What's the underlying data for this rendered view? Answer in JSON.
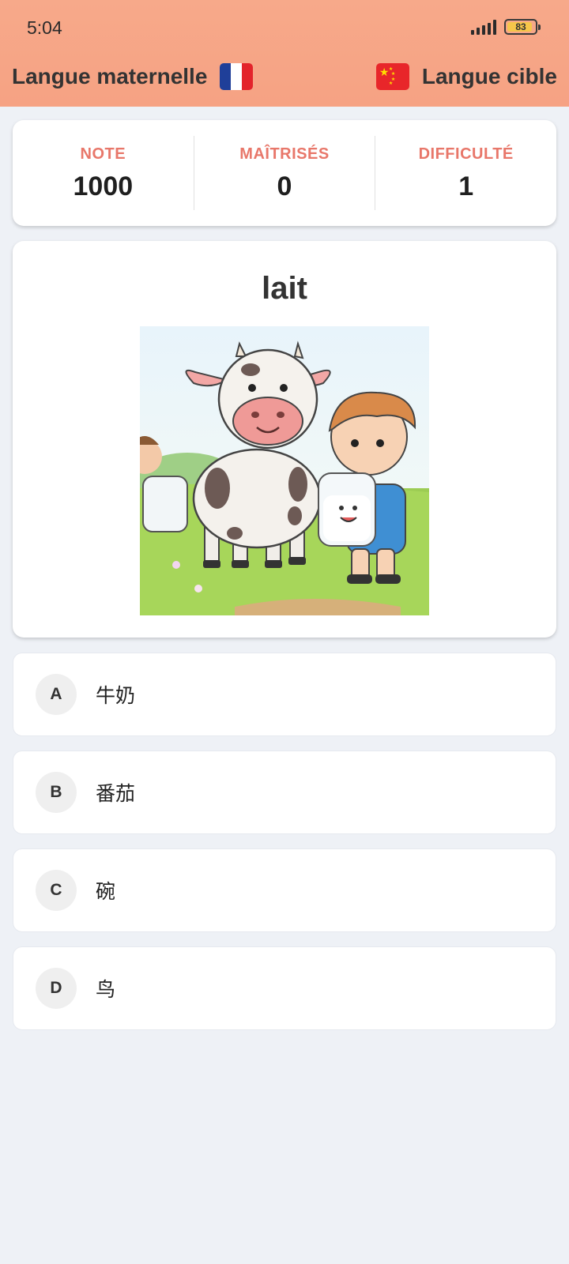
{
  "status_bar": {
    "time": "5:04",
    "battery_level": "83",
    "icons": [
      "signal-icon",
      "battery-icon"
    ]
  },
  "header": {
    "native_language_label": "Langue maternelle",
    "native_flag": "france-flag-icon",
    "target_language_label": "Langue cible",
    "target_flag": "china-flag-icon",
    "background_color": "#f7a98a"
  },
  "stats": {
    "note_label": "NOTE",
    "note_value": "1000",
    "mastered_label": "MAÎTRISÉS",
    "mastered_value": "0",
    "difficulty_label": "DIFFICULTÉ",
    "difficulty_value": "1",
    "label_color": "#e8776a"
  },
  "question": {
    "word": "lait",
    "image": "cow-and-children-drinking-milk-illustration"
  },
  "options": [
    {
      "letter": "A",
      "text": "牛奶"
    },
    {
      "letter": "B",
      "text": "番茄"
    },
    {
      "letter": "C",
      "text": "碗"
    },
    {
      "letter": "D",
      "text": "鸟"
    }
  ]
}
